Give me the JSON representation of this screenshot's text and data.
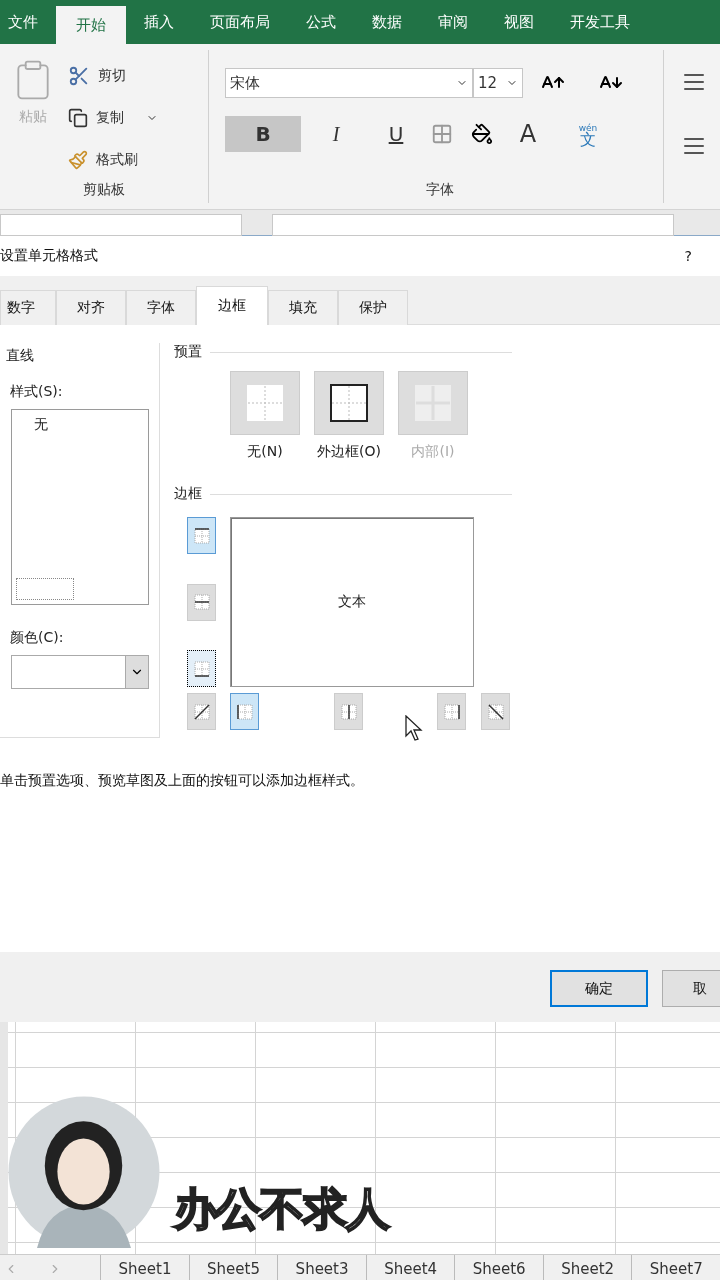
{
  "ribbon_tabs": [
    {
      "label": "文件",
      "selected": false
    },
    {
      "label": "开始",
      "selected": true
    },
    {
      "label": "插入",
      "selected": false
    },
    {
      "label": "页面布局",
      "selected": false
    },
    {
      "label": "公式",
      "selected": false
    },
    {
      "label": "数据",
      "selected": false
    },
    {
      "label": "审阅",
      "selected": false
    },
    {
      "label": "视图",
      "selected": false
    },
    {
      "label": "开发工具",
      "selected": false
    }
  ],
  "clipboard": {
    "paste": {
      "label": "粘贴",
      "disabled": true
    },
    "cut": "剪切",
    "copy": "复制",
    "format_painter": "格式刷",
    "group_label": "剪贴板"
  },
  "font": {
    "font_name": "宋体",
    "font_size": "12",
    "bold": {
      "label": "B",
      "on": true
    },
    "italic": "I",
    "underline": "U",
    "font_color": "A",
    "phonetic_top": "wén",
    "phonetic": "文",
    "group_label": "字体"
  },
  "dialog": {
    "title": "设置单元格格式",
    "help": "?",
    "tabs": [
      {
        "label": "数字",
        "selected": false
      },
      {
        "label": "对齐",
        "selected": false
      },
      {
        "label": "字体",
        "selected": false
      },
      {
        "label": "边框",
        "selected": true
      },
      {
        "label": "填充",
        "selected": false
      },
      {
        "label": "保护",
        "selected": false
      }
    ],
    "line": {
      "title": "直线",
      "style_label": "样式(S):",
      "first_style": "无",
      "color_label": "颜色(C):"
    },
    "presets": {
      "title": "预置",
      "items": [
        {
          "label": "无(N)",
          "kind": "none",
          "disabled": false
        },
        {
          "label": "外边框(O)",
          "kind": "outline",
          "disabled": false
        },
        {
          "label": "内部(I)",
          "kind": "inside",
          "disabled": true
        }
      ]
    },
    "border": {
      "title": "边框",
      "preview_text": "文本",
      "side_buttons": [
        {
          "kind": "top",
          "on": true,
          "focused": false
        },
        {
          "kind": "middle",
          "on": false,
          "focused": false
        },
        {
          "kind": "bottom",
          "on": false,
          "focused": true
        }
      ],
      "bottom_buttons": [
        {
          "kind": "diag-up",
          "on": false
        },
        {
          "kind": "left",
          "on": true
        },
        {
          "kind": "center",
          "on": false
        },
        {
          "kind": "right",
          "on": false
        },
        {
          "kind": "diag-down",
          "on": false
        }
      ]
    },
    "hint": "单击预置选项、预览草图及上面的按钮可以添加边框样式。",
    "buttons": [
      {
        "label": "确定",
        "default": true
      },
      {
        "label": "取",
        "default": false
      }
    ]
  },
  "caption": "办公不求人",
  "sheet_tabs": [
    "Sheet1",
    "Sheet5",
    "Sheet3",
    "Sheet4",
    "Sheet6",
    "Sheet2",
    "Sheet7"
  ]
}
